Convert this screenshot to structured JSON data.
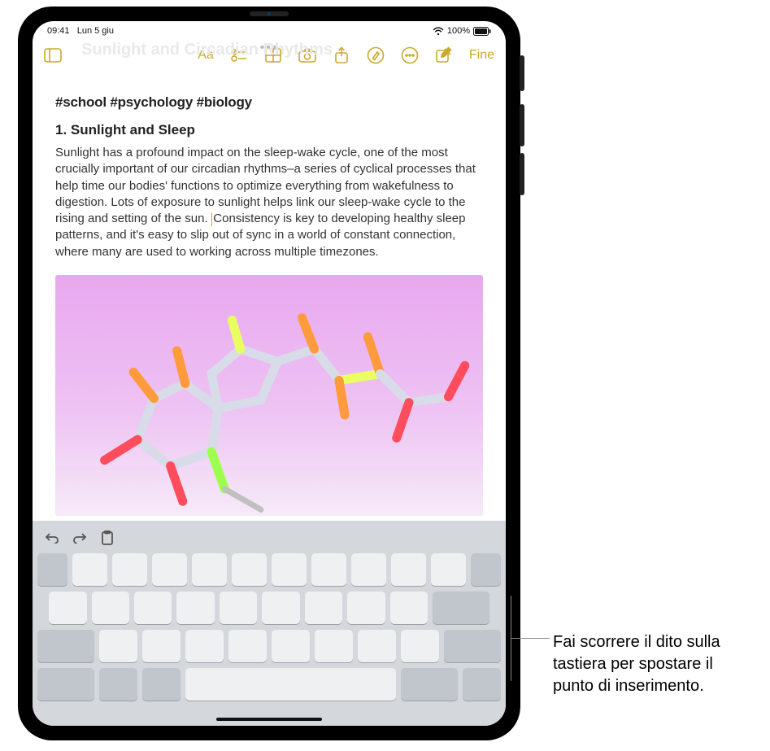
{
  "status": {
    "time": "09:41",
    "date": "Lun 5 giu",
    "battery_pct": "100%",
    "wifi_icon": "wifi-icon",
    "battery_icon": "battery-icon"
  },
  "title_ghost": "Sunlight and Circadian Rhythms",
  "toolbar": {
    "sidebar_icon": "sidebar-icon",
    "format_label": "Aa",
    "checklist_icon": "checklist-icon",
    "table_icon": "table-icon",
    "camera_icon": "camera-icon",
    "share_icon": "share-icon",
    "markup_icon": "markup-icon",
    "more_icon": "more-circle-icon",
    "compose_icon": "compose-icon",
    "done_label": "Fine"
  },
  "note": {
    "hashtags": "#school #psychology #biology",
    "section_number": "1.",
    "section_title": "Sunlight and Sleep",
    "body_before_caret": "Sunlight has a profound impact on the sleep-wake cycle, one of the most crucially important of our circadian rhythms–a series of cyclical processes that help time our bodies' functions to optimize everything from wakefulness to digestion. Lots of exposure to sunlight helps link our sleep-wake cycle to the rising and setting of the sun. ",
    "body_after_caret": "Consistency is key to developing healthy sleep patterns, and it's easy to slip out of sync in a world of constant connection, where many are used to working across multiple timezones.",
    "image_alt": "melatonin-molecule-3d"
  },
  "kb_shortcut": {
    "undo_icon": "undo-icon",
    "redo_icon": "redo-icon",
    "paste_icon": "clipboard-paste-icon"
  },
  "callout": {
    "text": "Fai scorrere il dito sulla tastiera per spostare il punto di inserimento."
  },
  "colors": {
    "accent": "#c9a92d",
    "key_bg": "#eef0f2",
    "key_mod": "#c1c6cc",
    "kb_bg": "#d4d7db"
  }
}
